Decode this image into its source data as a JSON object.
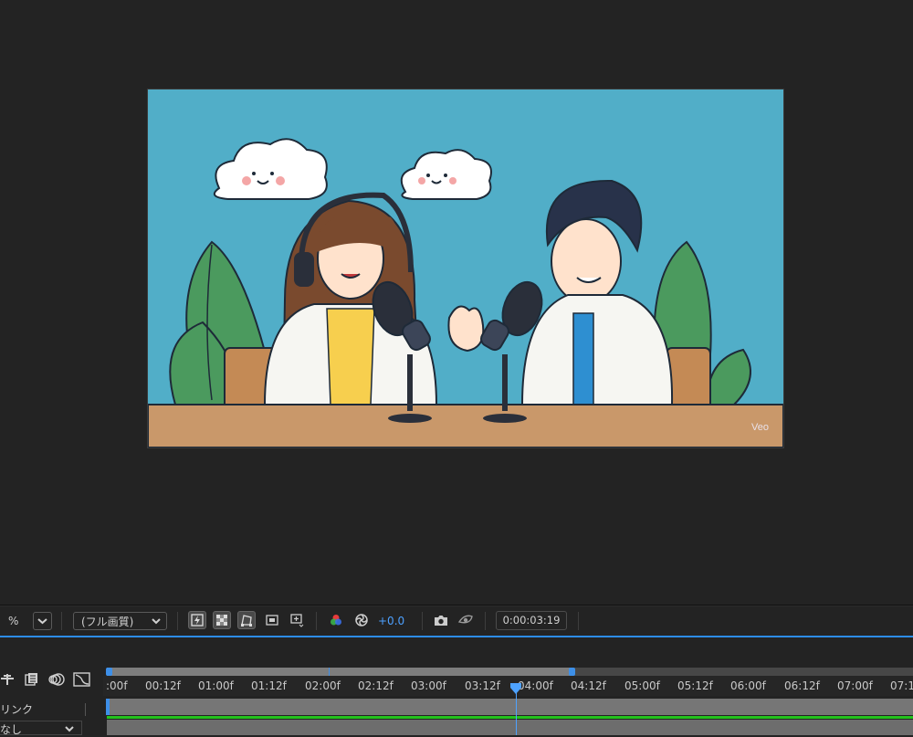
{
  "composition": {
    "watermark": "Veo",
    "colors": {
      "sky": "#51aec8",
      "table": "#c9986a",
      "leaf": "#4b9a5e"
    }
  },
  "toolbar": {
    "zoom_suffix": "%",
    "resolution": "(フル画質)",
    "exposure": "+0.0",
    "timecode": "0:00:03:19",
    "icons": [
      "fast-preview-icon",
      "transparency-grid-icon",
      "mask-path-icon",
      "region-of-interest-icon",
      "safe-margins-icon",
      "color-channel-icon",
      "reset-exposure-icon",
      "snapshot-icon",
      "show-snapshot-icon"
    ]
  },
  "timeline": {
    "ticks": [
      ":00f",
      "00:12f",
      "01:00f",
      "01:12f",
      "02:00f",
      "02:12f",
      "03:00f",
      "03:12f",
      "04:00f",
      "04:12f",
      "05:00f",
      "05:12f",
      "06:00f",
      "06:12f",
      "07:00f",
      "07:1"
    ],
    "left_panel": {
      "link_label": "リンク",
      "parent_value": "なし"
    },
    "playhead_accent": "#4ea2ff",
    "track_color": "#23c21c"
  }
}
